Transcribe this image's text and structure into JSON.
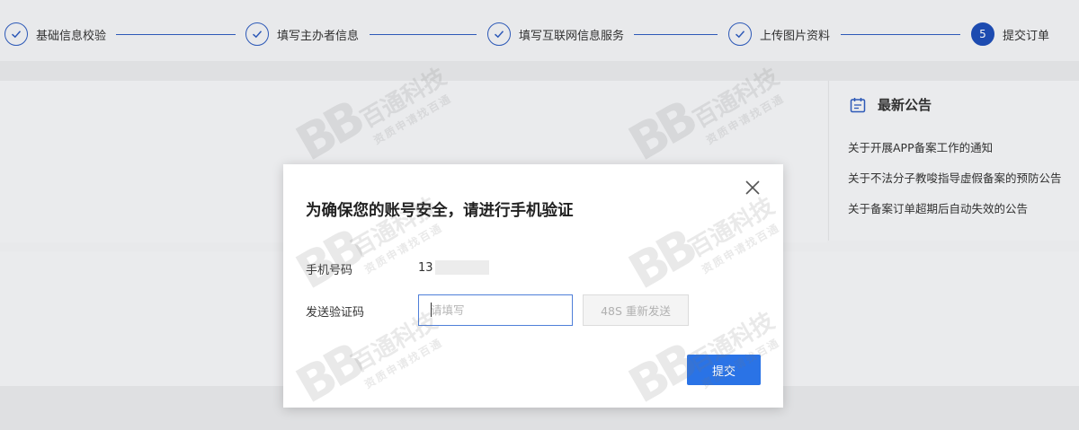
{
  "stepper": {
    "steps": [
      {
        "label": "基础信息校验",
        "state": "done"
      },
      {
        "label": "填写主办者信息",
        "state": "done"
      },
      {
        "label": "填写互联网信息服务",
        "state": "done"
      },
      {
        "label": "上传图片资料",
        "state": "done"
      },
      {
        "label": "提交订单",
        "state": "active",
        "number": "5"
      }
    ],
    "accent_color": "#2f5dbf"
  },
  "notice": {
    "title": "最新公告",
    "items": [
      "关于开展APP备案工作的通知",
      "关于不法分子教唆指导虚假备案的预防公告",
      "关于备案订单超期后自动失效的公告"
    ]
  },
  "watermark": {
    "logo": "BB",
    "brand": "百通科技",
    "tagline": "资质申请找百通"
  },
  "dialog": {
    "title": "为确保您的账号安全，请进行手机验证",
    "phone_label": "手机号码",
    "phone_value": "13",
    "code_label": "发送验证码",
    "code_placeholder": "请填写",
    "resend_label": "48S 重新发送",
    "submit_label": "提交",
    "primary_color": "#2a73e6"
  }
}
